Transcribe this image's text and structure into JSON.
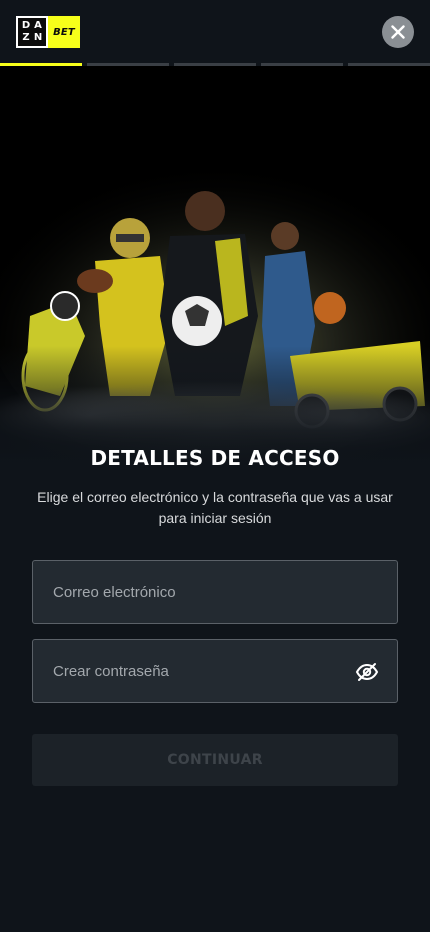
{
  "header": {
    "logo_dazn": [
      "D",
      "A",
      "Z",
      "N"
    ],
    "logo_bet": "BET",
    "close_icon": "close-icon"
  },
  "progress": {
    "total_steps": 5,
    "current_step": 1
  },
  "colors": {
    "accent": "#f7ff1a",
    "background": "#0f141a",
    "field_bg": "#232a31",
    "button_disabled_bg": "#1c2228",
    "button_disabled_text": "#3e444a"
  },
  "main": {
    "title": "DETALLES DE ACCESO",
    "subtitle": "Elige el correo electrónico y la contraseña que vas a usar para iniciar sesión",
    "email_placeholder": "Correo electrónico",
    "email_value": "",
    "password_placeholder": "Crear contraseña",
    "password_value": "",
    "password_toggle_icon": "eye-slash-icon",
    "continue_label": "CONTINUAR"
  }
}
